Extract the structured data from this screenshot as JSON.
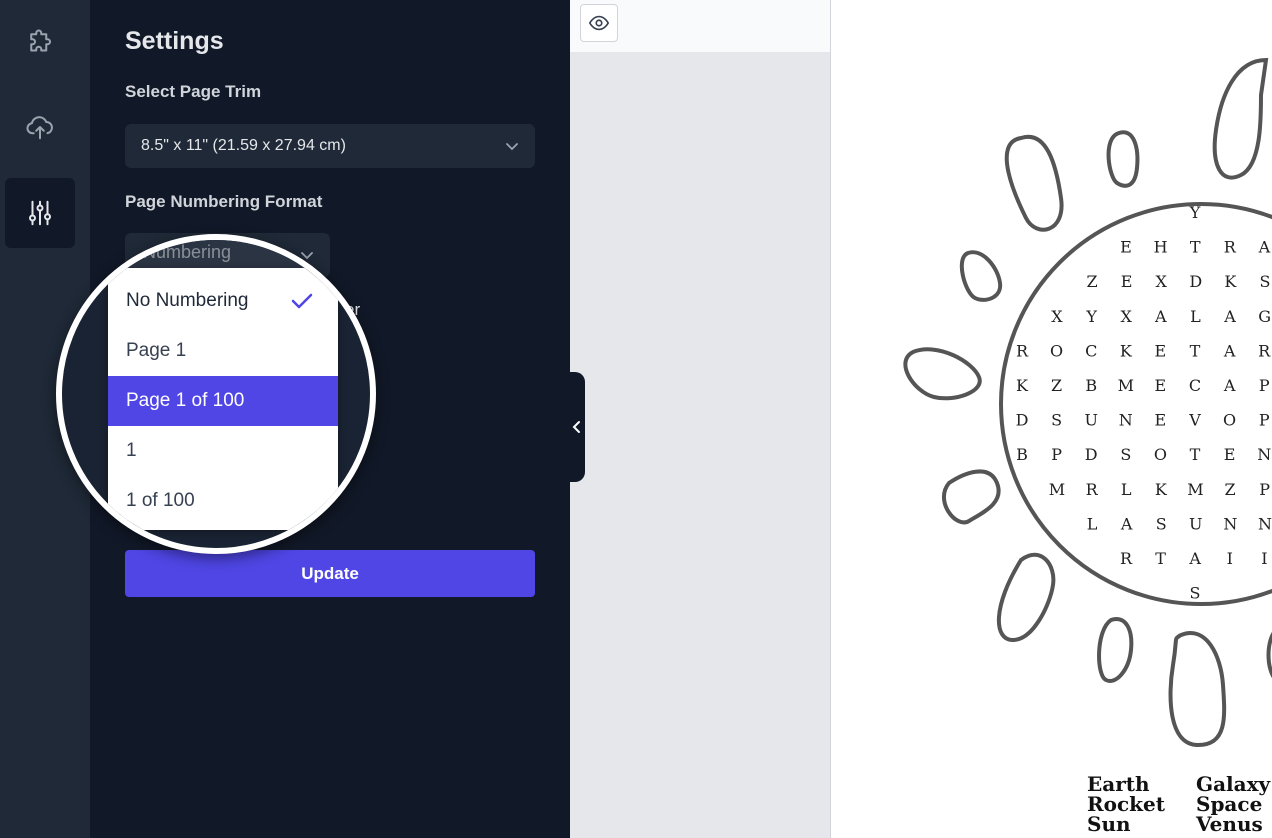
{
  "rail": {
    "items": [
      {
        "icon": "puzzle-icon"
      },
      {
        "icon": "cloud-upload-icon"
      },
      {
        "icon": "sliders-icon",
        "active": true
      }
    ]
  },
  "settings": {
    "title": "Settings",
    "page_trim_label": "Select Page Trim",
    "page_trim_value": "8.5\" x 11\" (21.59 x 27.94 cm)",
    "numbering_label": "Page Numbering Format",
    "numbering_value_partial": "Numbering",
    "hidden_partial_text": "er",
    "update_label": "Update"
  },
  "numbering_menu": {
    "options": [
      "No Numbering",
      "Page 1",
      "Page 1 of 100",
      "1",
      "1 of 100"
    ],
    "selected": "No Numbering",
    "highlighted": "Page 1 of 100"
  },
  "viewer": {
    "toolbar_icon": "eye-icon"
  },
  "puzzle": {
    "rows": [
      "Y",
      "E H T R A",
      "Z E X D K S",
      "X Y X A L A G",
      "R O C K E T A R",
      "K Z B M E C A P",
      "D S U N E V O P",
      "B P D S O T E N",
      "M R L K M Z P",
      "L A S U N N",
      "R T A I I",
      "S"
    ],
    "word_columns": [
      [
        "Earth",
        "Rocket",
        "Sun"
      ],
      [
        "Galaxy",
        "Space",
        "Venus"
      ]
    ]
  },
  "colors": {
    "accent": "#4f46e5",
    "sidebar_bg": "#111827",
    "rail_bg": "#1f2937"
  }
}
